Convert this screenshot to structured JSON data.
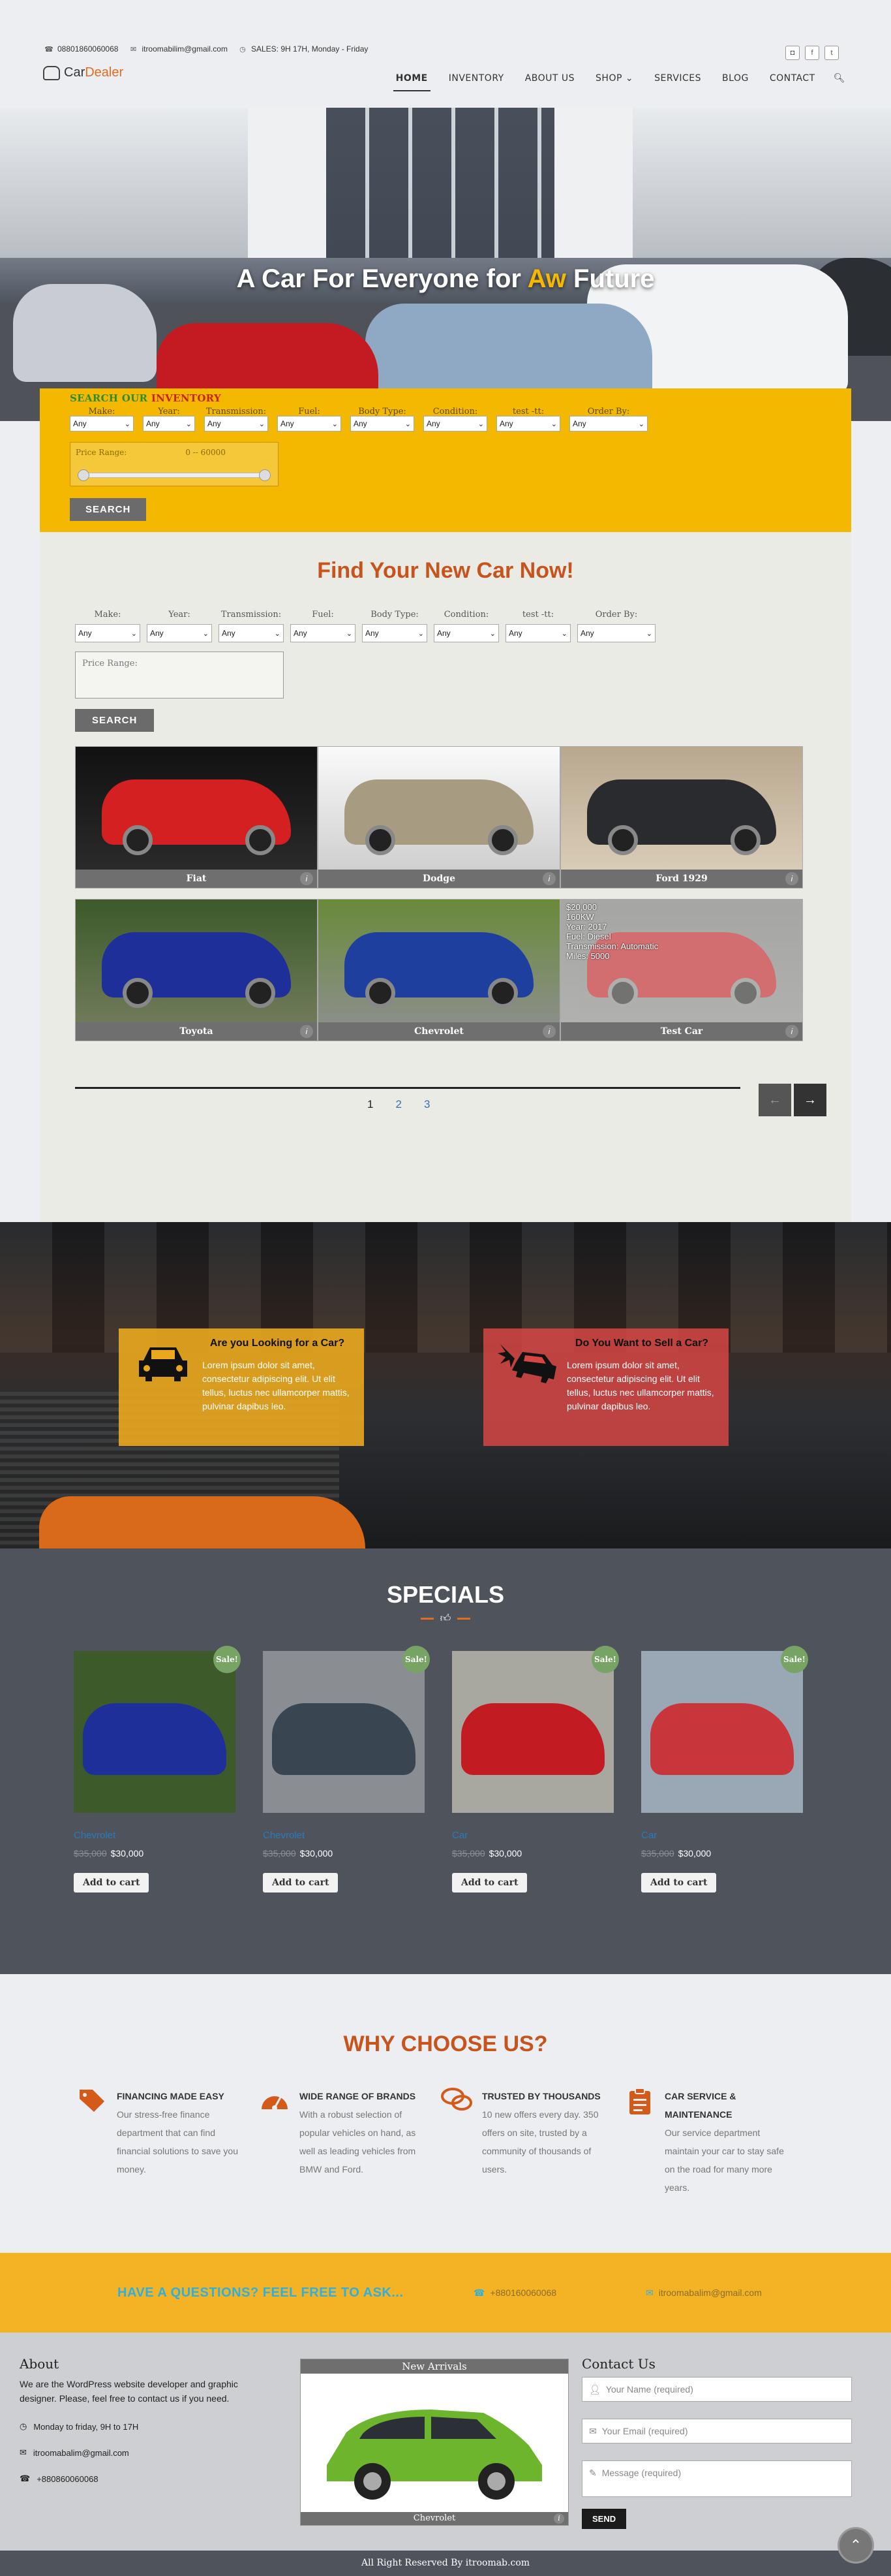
{
  "topbar": {
    "phone": "08801860060068",
    "email": "itroomabilim@gmail.com",
    "hours": "SALES: 9H 17H, Monday - Friday"
  },
  "brand": {
    "part1": "Car",
    "part2": "Dealer"
  },
  "nav": {
    "home": "HOME",
    "inventory": "INVENTORY",
    "about": "ABOUT US",
    "shop": "SHOP",
    "services": "SERVICES",
    "blog": "BLOG",
    "contact": "CONTACT"
  },
  "hero": {
    "title_a": "A Car For Everyone for ",
    "title_hl": "Aw",
    "title_b": " Future"
  },
  "yellow_search": {
    "heading_a": "SEARCH OUR ",
    "heading_b": "INVENTORY",
    "labels": [
      "Make:",
      "Year:",
      "Transmission:",
      "Fuel:",
      "Body Type:",
      "Condition:",
      "test -tt:",
      "Order By:"
    ],
    "any": "Any",
    "price_label": "Price Range:",
    "price_value": "0 -- 60000",
    "price_range_fraction": [
      0.0,
      1.0
    ],
    "button": "SEARCH"
  },
  "inventory": {
    "title": "Find Your New Car Now!",
    "labels": [
      "Make:",
      "Year:",
      "Transmission:",
      "Fuel:",
      "Body Type:",
      "Condition:",
      "test -tt:",
      "Order By:"
    ],
    "any": "Any",
    "price_label": "Price Range:",
    "button": "SEARCH",
    "cards": [
      {
        "name": "Fiat",
        "color": "#d42020"
      },
      {
        "name": "Dodge",
        "color": "#a79c82"
      },
      {
        "name": "Ford 1929",
        "color": "#2a2b2e"
      },
      {
        "name": "Toyota",
        "color": "#1e2f9a"
      },
      {
        "name": "Chevrolet",
        "color": "#1f3f9e"
      },
      {
        "name": "Test Car",
        "color": "#c21c22"
      }
    ],
    "overlay": [
      "$20,000",
      "160KW",
      "Year: 2017",
      "Fuel: Diesel",
      "Transmission: Automatic",
      "Miles: 5000"
    ],
    "pages": [
      "1",
      "2",
      "3"
    ]
  },
  "promo": {
    "buy_title": "Are you Looking for a Car?",
    "buy_text": "Lorem ipsum dolor sit amet, consectetur adipiscing elit. Ut elit tellus, luctus nec ullamcorper mattis, pulvinar dapibus leo.",
    "sell_title": "Do You Want to Sell a Car?",
    "sell_text": "Lorem ipsum dolor sit amet, consectetur adipiscing elit. Ut elit tellus, luctus nec ullamcorper mattis, pulvinar dapibus leo."
  },
  "specials": {
    "title": "SPECIALS",
    "sale": "Sale!",
    "cart": "Add to cart",
    "products": [
      {
        "name": "Chevrolet",
        "old": "$35,000",
        "price": "$30,000",
        "color": "#1e2f9a"
      },
      {
        "name": "Chevrolet",
        "old": "$35,000",
        "price": "$30,000",
        "color": "#3a4552"
      },
      {
        "name": "Car",
        "old": "$35,000",
        "price": "$30,000",
        "color": "#c21c22"
      },
      {
        "name": "Car",
        "old": "$35,000",
        "price": "$30,000",
        "color": "#c8353a"
      }
    ]
  },
  "why": {
    "title": "WHY CHOOSE US?",
    "features": [
      {
        "title": "FINANCING MADE EASY",
        "text": "Our stress-free finance department that can find financial solutions to save you money."
      },
      {
        "title": "WIDE RANGE OF BRANDS",
        "text": "With a robust selection of popular vehicles on hand, as well as leading vehicles from BMW and Ford."
      },
      {
        "title": "TRUSTED BY THOUSANDS",
        "text": "10 new offers every day. 350 offers on site, trusted by a community of thousands of users."
      },
      {
        "title": "CAR SERVICE & MAINTENANCE",
        "text": "Our service department maintain your car to stay safe on the road for many more years."
      }
    ]
  },
  "cta": {
    "question": "HAVE A QUESTIONS? FEEL FREE TO ASK...",
    "phone": "+880160060068",
    "email": "itroomabalim@gmail.com"
  },
  "footer": {
    "about_title": "About",
    "about_text": "We are the WordPress website developer and graphic designer. Please, feel free to contact us if you need.",
    "hours": "Monday to friday, 9H to 17H",
    "email": "itroomabalim@gmail.com",
    "phone": "+880860060068",
    "arrivals_title": "New Arrivals",
    "arrivals_car": "Chevrolet",
    "contact_title": "Contact Us",
    "name_ph": "Your Name (required)",
    "email_ph": "Your Email (required)",
    "msg_ph": "Message (required)",
    "send": "SEND",
    "copyright": "All Right Reserved By itroomab.com"
  },
  "colors": {
    "accent": "#c6541c",
    "yellow": "#f5b800",
    "slate": "#4f545c",
    "link": "#2a7ab8"
  }
}
